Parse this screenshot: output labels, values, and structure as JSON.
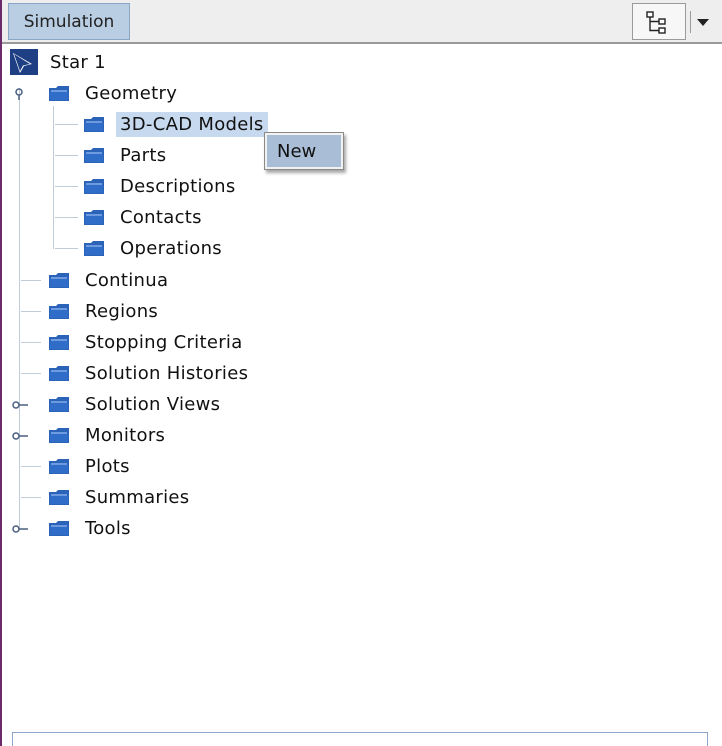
{
  "toolbar": {
    "tab_label": "Simulation",
    "view_icon": "tree-view-icon",
    "dropdown_icon": "chevron-down-icon"
  },
  "tree": {
    "root": {
      "label": "Star 1",
      "icon": "star-ccm-logo-icon"
    },
    "items": [
      {
        "label": "Geometry",
        "expanded": true
      },
      {
        "label": "3D-CAD Models",
        "selected": true
      },
      {
        "label": "Parts"
      },
      {
        "label": "Descriptions"
      },
      {
        "label": "Contacts"
      },
      {
        "label": "Operations"
      },
      {
        "label": "Continua"
      },
      {
        "label": "Regions"
      },
      {
        "label": "Stopping Criteria"
      },
      {
        "label": "Solution Histories"
      },
      {
        "label": "Solution Views",
        "expandable": true
      },
      {
        "label": "Monitors",
        "expandable": true
      },
      {
        "label": "Plots"
      },
      {
        "label": "Summaries"
      },
      {
        "label": "Tools",
        "expandable": true
      }
    ]
  },
  "context_menu": {
    "items": [
      {
        "label": "New"
      }
    ]
  },
  "colors": {
    "selection": "#c7d9ee",
    "menu_highlight": "#a9bdd6",
    "tab_background": "#b9cde3",
    "folder_blue": "#2a63b8"
  }
}
